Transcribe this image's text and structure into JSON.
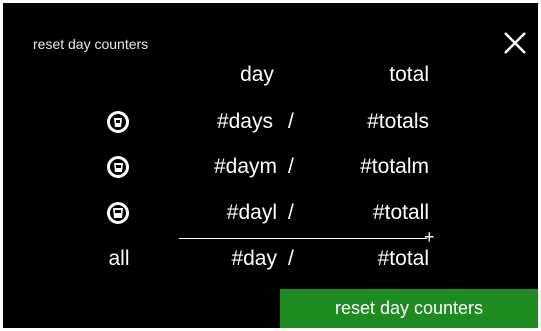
{
  "title": "reset day counters",
  "close_icon": "close-icon",
  "headers": {
    "day": "day",
    "total": "total"
  },
  "rows": [
    {
      "icon": "cup-small-icon",
      "day": "#days",
      "sep": "/",
      "total": "#totals"
    },
    {
      "icon": "cup-medium-icon",
      "day": "#daym",
      "sep": "/",
      "total": "#totalm"
    },
    {
      "icon": "cup-large-icon",
      "day": "#dayl",
      "sep": "/",
      "total": "#totall"
    }
  ],
  "sum": {
    "plus": "+",
    "label": "all",
    "day": "#day",
    "sep": "/",
    "total": "#total"
  },
  "reset_button": {
    "label": "reset day counters",
    "color": "#1f8a1f"
  }
}
